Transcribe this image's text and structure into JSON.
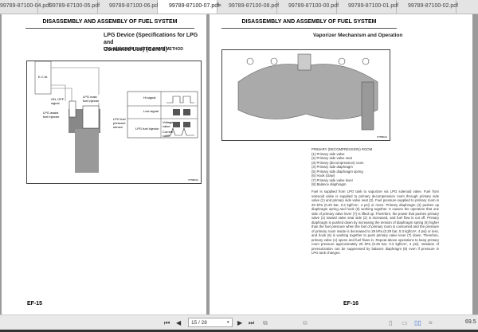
{
  "tabs": [
    {
      "label": "99789-87100-04.pdf"
    },
    {
      "label": "99789-87100-05.pdf"
    },
    {
      "label": "99789-87100-06.pdf"
    },
    {
      "label": "99789-87100-07.pdf",
      "active": true
    },
    {
      "label": "99789-87100-08.pdf"
    },
    {
      "label": "99789-87100-00.pdf"
    },
    {
      "label": "99789-87100-01.pdf"
    },
    {
      "label": "99789-87100-02.pdf"
    }
  ],
  "close": "×",
  "left": {
    "header": "DISASSEMBLY AND ASSEMBLY OF FUEL SYSTEM",
    "title1": "LPG Device (Specifications for LPG and",
    "title2": "Combined Use) (Cont'd)",
    "subtitle": "LPG INJECTION SYSTEM DRIVE METHOD",
    "labels": {
      "ecm": "E.C.M.",
      "onoff": "ON, OFF signal",
      "assist": "LPG assist fuel injector",
      "main": "LPG main fuel injector",
      "sensor": "LPG fuel pressure sensor",
      "hi": "Hi signal",
      "low": "Low signal",
      "inj": "LPG fuel injector",
      "volt": "Voltage value",
      "curr": "Current value",
      "code": "ST5B02A"
    },
    "page": "EF-15"
  },
  "right": {
    "header": "DISASSEMBLY AND ASSEMBLY OF FUEL SYSTEM",
    "title": "Vaporizer Mechanism and Operation",
    "code": "ST5B02A",
    "list_title": "PRIMARY (DECOMPRESSION) ROOM",
    "items": [
      "(1)  Primary side valve",
      "(2)  Primary side valve seat",
      "(3)  Primary (decompression) room",
      "(4)  Primary side diaphragm",
      "(5)  Primary side diaphragm spring",
      "(6)  Hook (claw)",
      "(7)  Primary side valve lever",
      "(8)  Balance diaphragm"
    ],
    "body": "Fuel is supplied from LPG tank to vaporizer via LPG solenoid valve. Fuel from solenoid valve is supplied to primary decompression room through primary side valve (1) and primary side valve seat (2). Fuel pressure supplied to primary room is 29 kPa (0.29 bar, 0.3 kgf/cm², 4 psi) or more. Primary diaphragm (4) pushes up diaphragm spring and hook (6) working together. It causes the operation that one side of primary valve lever (7) is lifted up. Therefore, the power that pushes primary valve (1) toward valve seat side (2) is increased, and fuel flow is cut off. Primary diaphragm is pushed down by increasing the tension of diaphragm spring (5) higher than the fuel pressure when the fuel of primary room is consumed and the pressure of primary room inside is decreased to 29 kPa (0.29 bar, 0.3 kgf/cm², 4 psi) or less, and hook (6) is working together to push primary valve lever (7) down. Therefore, primary valve (1) opens and fuel flows in. Repeat above operations to keep primary room pressure approximately 29 kPa (0.29 bar, 0.3 kgf/cm², 4 psi). Variation of pressurization can be suppressed by balance diaphragm (8) even if pressure in LPG tank changes.",
    "page": "EF-16"
  },
  "toolbar": {
    "page_value": "15 / 28",
    "zoom": "69.5"
  }
}
